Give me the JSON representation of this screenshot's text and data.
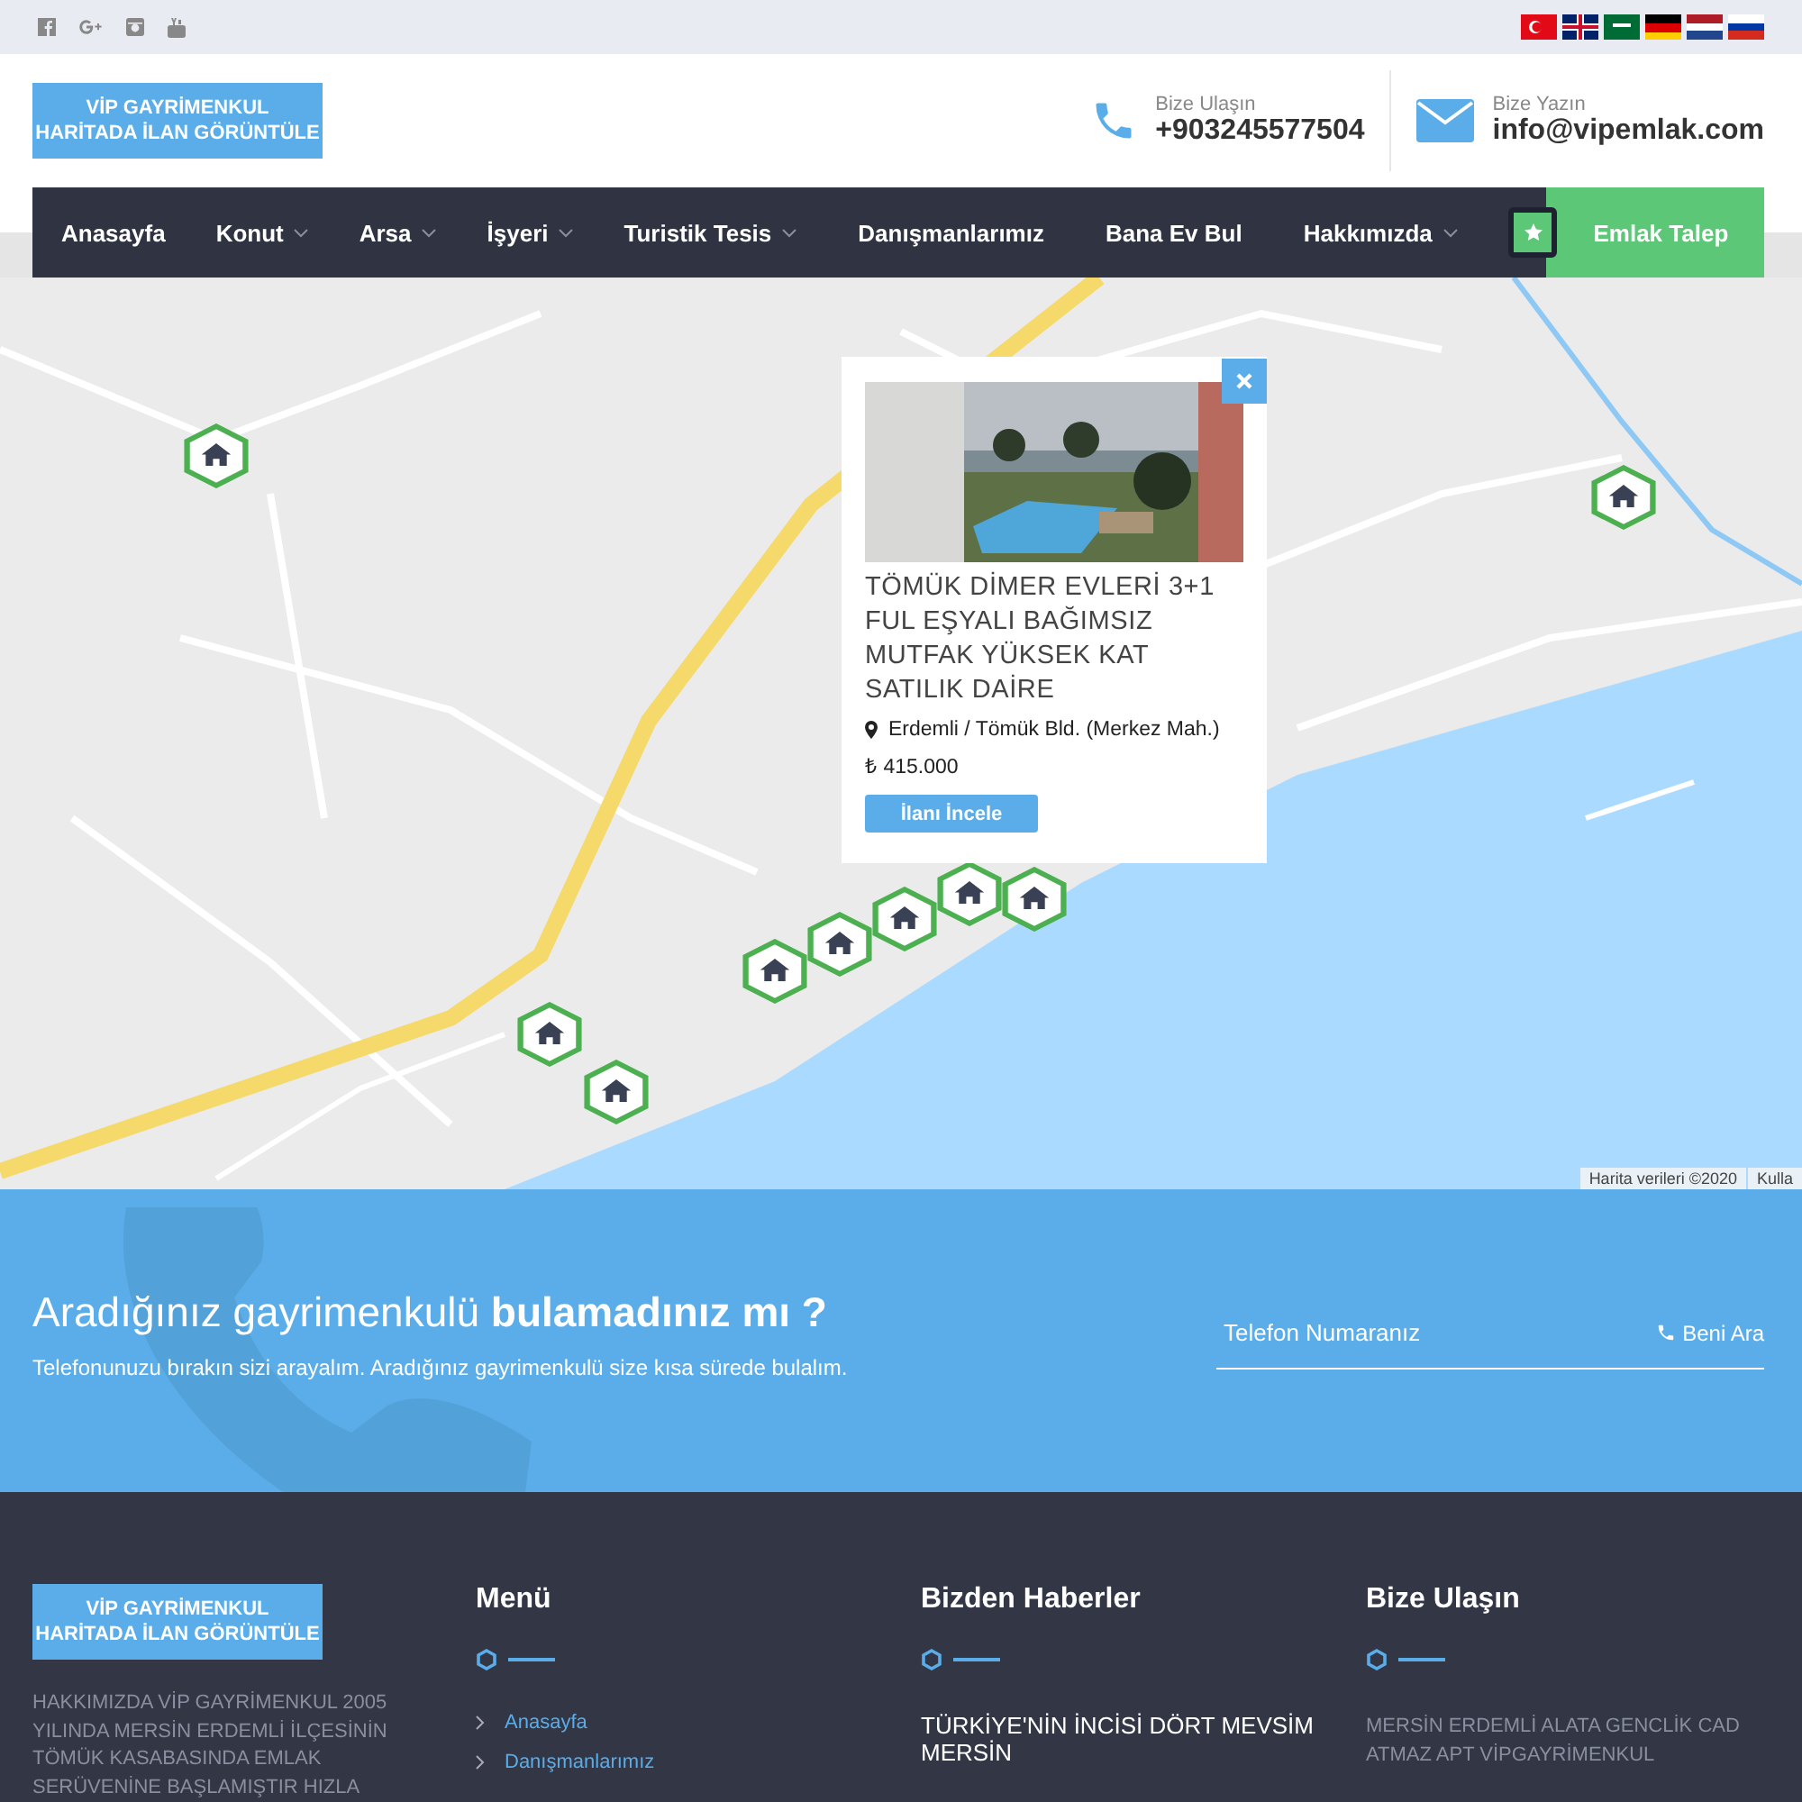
{
  "logo": {
    "line1": "VİP GAYRİMENKUL",
    "line2": "HARİTADA İLAN GÖRÜNTÜLE"
  },
  "contacts": [
    {
      "kind": "phone",
      "label": "Bize Ulaşın",
      "value": "+903245577504"
    },
    {
      "kind": "mail",
      "label": "Bize Yazın",
      "value": "info@vipemlak.com"
    }
  ],
  "nav": {
    "items": [
      {
        "label": "Anasayfa",
        "has_dropdown": false
      },
      {
        "label": "Konut",
        "has_dropdown": true
      },
      {
        "label": "Arsa",
        "has_dropdown": true
      },
      {
        "label": "İşyeri",
        "has_dropdown": true
      },
      {
        "label": "Turistik Tesis",
        "has_dropdown": true
      },
      {
        "label": "Danışmanlarımız",
        "has_dropdown": false
      },
      {
        "label": "Bana Ev Bul",
        "has_dropdown": false
      },
      {
        "label": "Hakkımızda",
        "has_dropdown": true
      }
    ],
    "cta": "Emlak Talep"
  },
  "map": {
    "popup": {
      "title": "TÖMÜK DİMER EVLERİ 3+1 FUL EŞYALI BAĞIMSIZ MUTFAK YÜKSEK KAT SATILIK DAİRE",
      "location": "Erdemli / Tömük Bld. (Merkez Mah.)",
      "price": "₺ 415.000",
      "button": "İlanı İncele"
    },
    "attribution": [
      "Harita verileri ©2020",
      "Kulla"
    ]
  },
  "callback": {
    "heading": "Aradığınız gayrimenkulü **bulamadınız mı ?**",
    "subtitle": "Telefonunuzu bırakın sizi arayalım. Aradığınız gayrimenkulü size kısa sürede bulalım.",
    "phone_placeholder": "Telefon Numaranız",
    "button": "Beni Ara"
  },
  "footer": {
    "logo": {
      "line1": "VİP GAYRİMENKUL",
      "line2": "HARİTADA İLAN GÖRÜNTÜLE"
    },
    "about": "HAKKIMIZDA VİP GAYRİMENKUL 2005 YILINDA MERSİN ERDEMLİ İLÇESİNİN TÖMÜK KASABASINDA EMLAK SERÜVENİNE BAŞLAMIŞTIR HIZLA",
    "columns": [
      {
        "title": "Menü",
        "kind": "links",
        "items": [
          "Anasayfa",
          "Danışmanlarımız"
        ]
      },
      {
        "title": "Bizden Haberler",
        "kind": "news",
        "items": [
          "TÜRKİYE'NİN İNCİSİ DÖRT MEVSİM MERSİN"
        ]
      },
      {
        "title": "Bize Ulaşın",
        "kind": "address",
        "items": [
          "MERSİN ERDEMLİ ALATA GENCLİK CAD ATMAZ APT VİPGAYRİMENKUL"
        ]
      }
    ]
  }
}
